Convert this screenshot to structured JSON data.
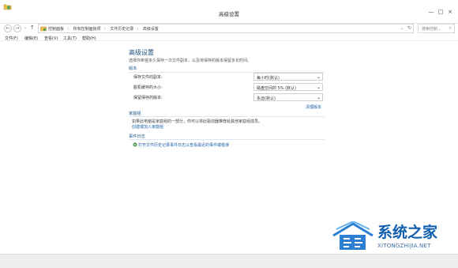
{
  "window": {
    "title": "高级设置",
    "controls": {
      "minimize": "—",
      "maximize": "□",
      "close": "×"
    }
  },
  "navigation": {
    "breadcrumbs": [
      "控制面板",
      "所有控制面板项",
      "文件历史记录",
      "高级设置"
    ],
    "search_placeholder": "搜索控制..."
  },
  "menu": [
    "文件(F)",
    "编辑(E)",
    "查看(V)",
    "工具(T)",
    "帮助(H)"
  ],
  "page": {
    "title": "高级设置",
    "description": "选择你希望多久保存一次文件副本，以及将保存的版本保留多长时间。",
    "versions_section": "版本",
    "settings": [
      {
        "label": "保存文件的副本:",
        "value": "每小时(默认)"
      },
      {
        "label": "脱机缓存的大小:",
        "value": "磁盘空间的 5% (默认)"
      },
      {
        "label": "保留保存的版本:",
        "value": "永远(默认)"
      }
    ],
    "cleanup_link": "清理版本",
    "family_section": "家庭组",
    "family_text": "如果此电脑是家庭组的一部分，你可以将此驱动器推荐给其他家庭组成员。",
    "family_link": "创建或加入家庭组",
    "events_section": "事件日志",
    "event_link": "打开文件历史记录事件日志以查看最近的事件或错误"
  },
  "watermark": {
    "title": "系统之家",
    "url": "XITONGZHIJIA.NET"
  }
}
